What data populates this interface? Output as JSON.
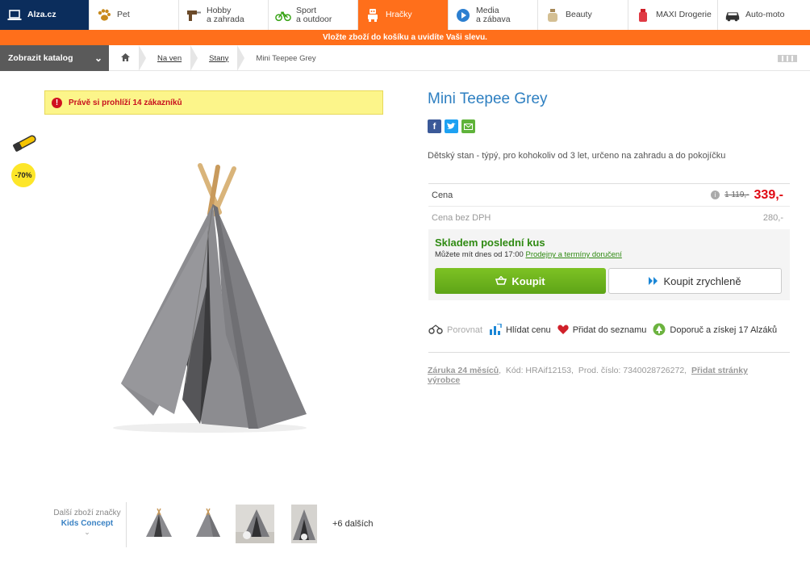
{
  "topnav": {
    "items": [
      {
        "label": "Alza.cz",
        "icon": "laptop-icon"
      },
      {
        "label": "Pet",
        "icon": "paw-icon"
      },
      {
        "label": "Hobby\na zahrada",
        "icon": "drill-icon"
      },
      {
        "label": "Sport\na outdoor",
        "icon": "bicycle-icon"
      },
      {
        "label": "Hračky",
        "icon": "robot-icon"
      },
      {
        "label": "Media\na zábava",
        "icon": "play-icon"
      },
      {
        "label": "Beauty",
        "icon": "cream-icon"
      },
      {
        "label": "MAXI Drogerie",
        "icon": "spray-icon"
      },
      {
        "label": "Auto-moto",
        "icon": "car-icon"
      }
    ]
  },
  "promo": {
    "text": "Vložte zboží do košíku a uvidíte Vaši slevu."
  },
  "breadcrumb": {
    "catalog_label": "Zobrazit katalog",
    "items": [
      "Na ven",
      "Stany",
      "Mini Teepee Grey"
    ]
  },
  "alert": {
    "text": "Právě si prohlíží 14 zákazníků"
  },
  "badges": {
    "discount": "-70%"
  },
  "thumbs": {
    "brand_caption": "Další zboží značky",
    "brand_name": "Kids Concept",
    "more": "+6 dalších"
  },
  "product": {
    "title": "Mini Teepee Grey",
    "description": "Dětský stan - týpý, pro kohokoliv od 3 let, určeno na zahradu a do pokojíčku",
    "price_label": "Cena",
    "old_price": "1 119,-",
    "price": "339,-",
    "price_nodph_label": "Cena bez DPH",
    "price_nodph": "280,-",
    "stock": "Skladem poslední kus",
    "delivery_text": "Můžete mít dnes od 17:00",
    "delivery_link": "Prodejny a termíny doručení",
    "buy_label": "Koupit",
    "fastbuy_label": "Koupit zrychleně"
  },
  "actions": {
    "compare": "Porovnat",
    "watch_price": "Hlídat cenu",
    "add_list": "Přidat do seznamu",
    "recommend": "Doporuč a získej 17 Alzáků"
  },
  "meta": {
    "warranty": "Záruka 24 měsíců",
    "code": "Kód: HRAif12153,",
    "prod_no": "Prod. číslo: 7340028726272,",
    "add_pages": "Přidat stránky výrobce"
  },
  "colors": {
    "accent": "#ff6f1b",
    "title": "#2d7fc1",
    "price": "#e00812",
    "stock": "#2f8a12"
  }
}
